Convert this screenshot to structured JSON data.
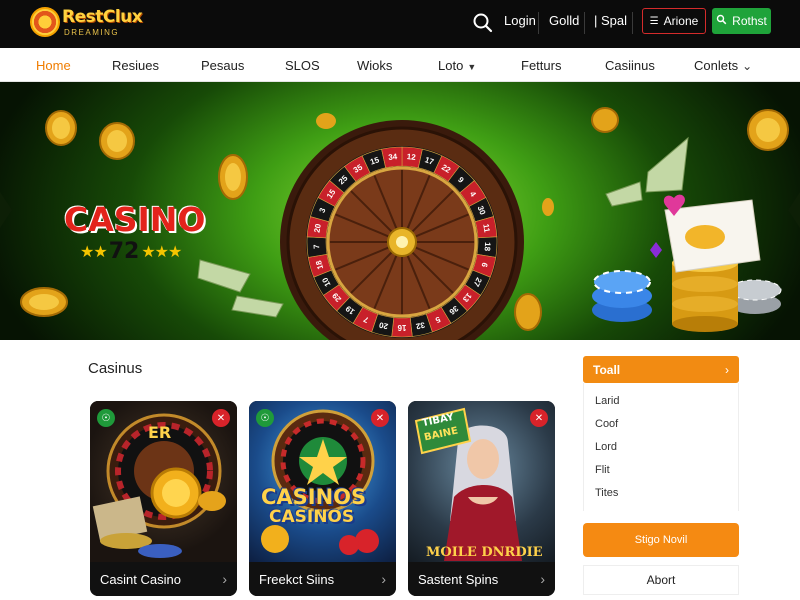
{
  "brand": {
    "name": "RestClux",
    "tagline": "DREAMING"
  },
  "topbar": {
    "links": [
      "Login",
      "Golld",
      "| Spal"
    ],
    "outline_button": "Arione",
    "green_button": "Rothst"
  },
  "nav": {
    "items": [
      "Home",
      "Resiues",
      "Pesaus",
      "SLOS",
      "Wioks",
      "Loto",
      "Fetturs",
      "Casiinus",
      "Conlets"
    ]
  },
  "hero": {
    "title": "CASINO",
    "number": "72",
    "wheel_numbers": [
      "12",
      "17",
      "22",
      "9",
      "4",
      "30",
      "11",
      "18",
      "6",
      "27",
      "13",
      "36",
      "5",
      "32",
      "16",
      "20",
      "7",
      "19",
      "29",
      "10",
      "18",
      "7",
      "20",
      "3",
      "15",
      "25",
      "35",
      "15",
      "34"
    ]
  },
  "section": {
    "title": "Casinus"
  },
  "cards": [
    {
      "label": "Casint Casino",
      "art_text": "ER"
    },
    {
      "label": "Freekct Siins",
      "art_text_1": "CASINOS",
      "art_text_2": "CASINOS"
    },
    {
      "label": "Sastent Spins",
      "art_text_1": "TIBAY",
      "art_text_2": "BAINE",
      "art_text_3": "MOILE DNRDIE"
    }
  ],
  "side": {
    "header": "Toall",
    "items": [
      "Larid",
      "Coof",
      "Lord",
      "Flit",
      "Tites"
    ],
    "cta": "Stigo Novil",
    "about": "Abort"
  },
  "colors": {
    "accent": "#f28b12",
    "green": "#1fa33a",
    "red": "#d42b2b"
  }
}
